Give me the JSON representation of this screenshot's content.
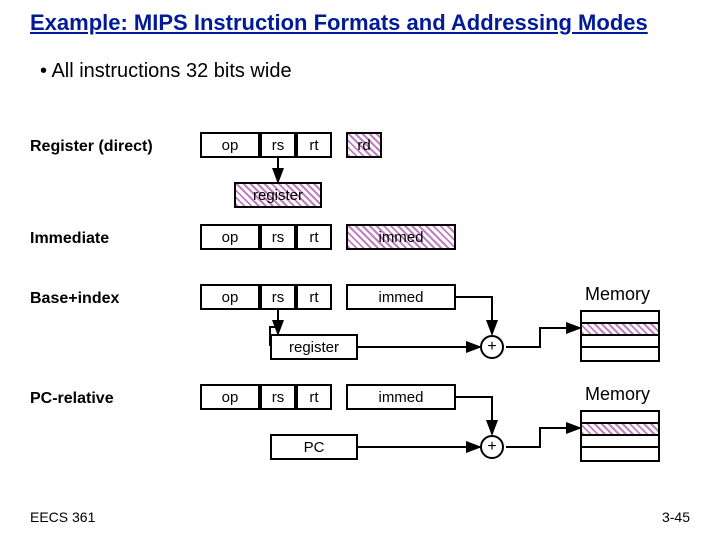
{
  "title": "Example: MIPS Instruction Formats and Addressing Modes",
  "subtitle": "• All instructions 32 bits wide",
  "labels": {
    "register_direct": "Register (direct)",
    "immediate": "Immediate",
    "base_index": "Base+index",
    "pc_relative": "PC-relative"
  },
  "fields": {
    "op": "op",
    "rs": "rs",
    "rt": "rt",
    "rd": "rd",
    "immed": "immed",
    "register": "register",
    "pc": "PC",
    "plus": "+",
    "memory": "Memory"
  },
  "footer": {
    "left": "EECS 361",
    "right": "3-45"
  }
}
